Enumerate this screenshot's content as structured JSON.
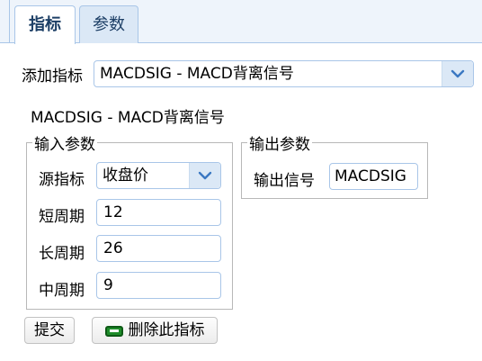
{
  "tabs": [
    {
      "label": "指标",
      "active": true
    },
    {
      "label": "参数",
      "active": false
    }
  ],
  "add_indicator": {
    "label": "添加指标",
    "selected": "MACDSIG - MACD背离信号"
  },
  "indicator_heading": "MACDSIG - MACD背离信号",
  "input_params": {
    "legend": "输入参数",
    "source": {
      "label": "源指标",
      "selected": "收盘价"
    },
    "short_period": {
      "label": "短周期",
      "value": "12"
    },
    "long_period": {
      "label": "长周期",
      "value": "26"
    },
    "mid_period": {
      "label": "中周期",
      "value": "9"
    }
  },
  "output_params": {
    "legend": "输出参数",
    "signal": {
      "label": "输出信号",
      "value": "MACDSIG"
    }
  },
  "buttons": {
    "submit": "提交",
    "delete": "删除此指标"
  },
  "colors": {
    "accent_blue": "#a9c6e8",
    "tab_bg": "#eef4fb",
    "delete_icon_green": "#1e8d2a"
  }
}
